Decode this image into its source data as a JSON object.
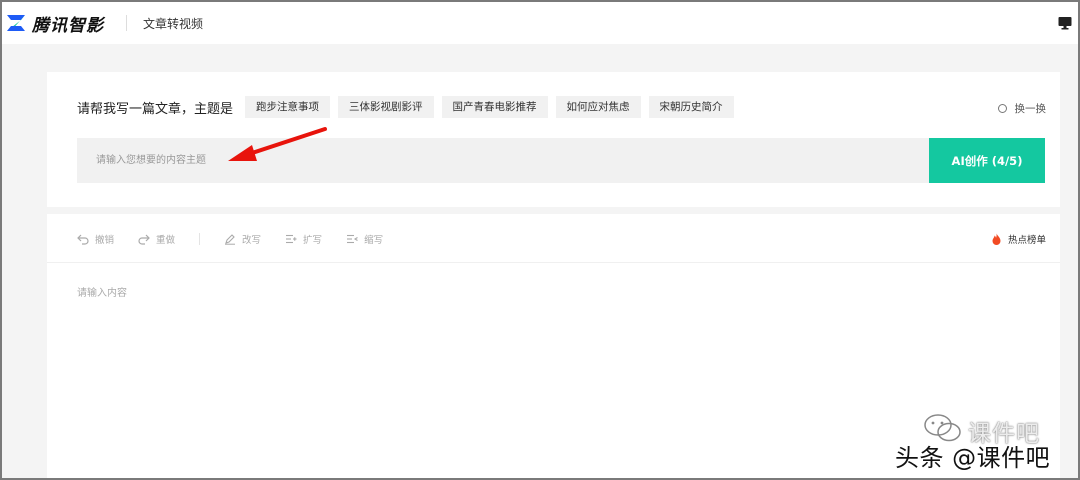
{
  "header": {
    "logo_text": "腾讯智影",
    "title": "文章转视频"
  },
  "prompt": {
    "label": "请帮我写一篇文章，主题是",
    "chips": [
      "跑步注意事项",
      "三体影视剧影评",
      "国产青春电影推荐",
      "如何应对焦虑",
      "宋朝历史简介"
    ],
    "refresh_label": "换一换",
    "input_placeholder": "请输入您想要的内容主题",
    "input_value": "",
    "ai_button_label": "AI创作 (4/5)"
  },
  "editor": {
    "toolbar": {
      "undo_label": "撤销",
      "redo_label": "重做",
      "rewrite_label": "改写",
      "expand_label": "扩写",
      "shrink_label": "缩写",
      "hot_list_label": "热点榜单"
    },
    "content_placeholder": "请输入内容"
  },
  "watermark": {
    "line1": "课件吧",
    "line2": "头条 @课件吧"
  },
  "colors": {
    "accent": "#14c8a0",
    "annotation_arrow": "#e8140c",
    "hot_icon": "#f24b24",
    "logo_blue": "#1e5bf6",
    "logo_green": "#15c9a0"
  }
}
